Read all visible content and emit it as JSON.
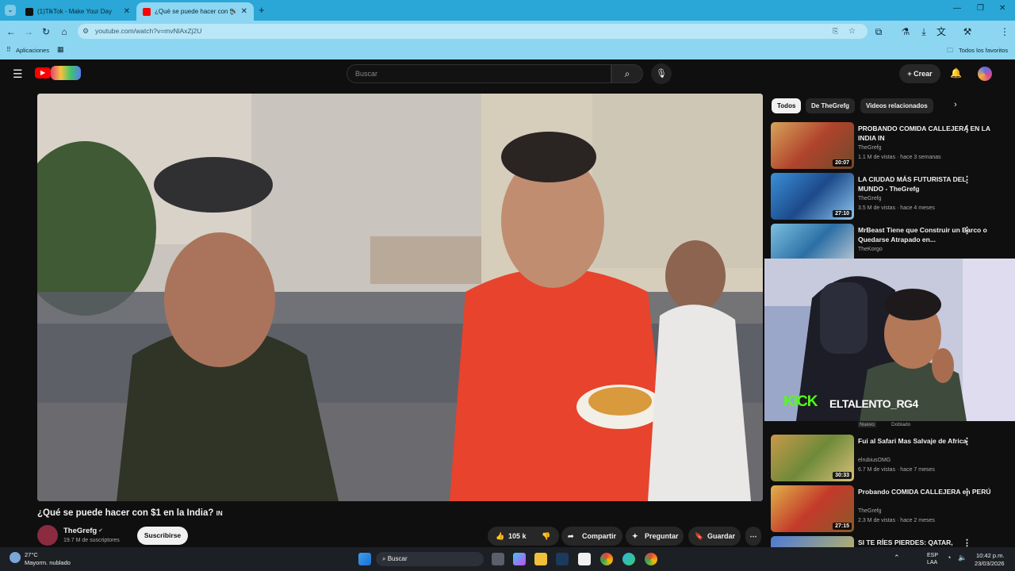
{
  "tabs": [
    {
      "label": "(1)TikTok - Make Your Day"
    },
    {
      "label": "¿Qué se puede hacer con $"
    }
  ],
  "address": "youtube.com/watch?v=mvNlAxZj2U",
  "bookmarks": {
    "apps": "Aplicaciones",
    "favorites": "Todos los favoritos"
  },
  "youtube": {
    "search_placeholder": "Buscar",
    "create_label": "Crear",
    "chips": [
      "Todos",
      "De TheGrefg",
      "Videos relacionados"
    ],
    "video_title": "¿Qué se puede hacer con $1 en la India? ",
    "video_title_badge": "IN",
    "channel": "TheGrefg",
    "subscribers": "19.7 M de suscriptores",
    "subscribe_label": "Suscribirse",
    "likes": "105 k",
    "share_label": "Compartir",
    "ask_label": "Preguntar",
    "save_label": "Guardar"
  },
  "recommendations": [
    {
      "title": "PROBANDO COMIDA CALLEJERA EN LA INDIA IN",
      "channel": "TheGrefg",
      "meta": "1.1 M de vistas · hace 3 semanas",
      "duration": "20:07"
    },
    {
      "title": "LA CIUDAD MÁS FUTURISTA DEL MUNDO - TheGrefg",
      "channel": "TheGrefg",
      "meta": "3.5 M de vistas · hace 4 meses",
      "duration": "27:10"
    },
    {
      "title": "MrBeast Tiene que Construir un Barco o Quedarse Atrapado en...",
      "channel": "TheKorgo",
      "meta": "",
      "duration": ""
    },
    {
      "title": "Fui al Safari Mas Salvaje de Africa",
      "channel": "elrubiusOMG",
      "meta": "6.7 M de vistas · hace 7 meses",
      "duration": "30:33"
    },
    {
      "title": "Probando COMIDA CALLEJERA en PERÚ",
      "channel": "TheGrefg",
      "meta": "2.3 M de vistas · hace 2 meses",
      "duration": "27:15"
    },
    {
      "title": "SI TE RÍES PIERDES: QATAR,",
      "channel": "",
      "meta": "",
      "duration": ""
    }
  ],
  "overlay": {
    "new_badge": "Nuevo",
    "dubbed_badge": "Doblado",
    "kick": "KICK",
    "streamer": "ELTALENTO_RG4"
  },
  "taskbar": {
    "weather_temp": "27°C",
    "weather_desc": "Mayorm. nublado",
    "search": "Buscar",
    "lang1": "ESP",
    "lang2": "LAA",
    "time": "10:42 p.m.",
    "date": "23/03/2026"
  },
  "colors": {
    "chrome_tabbar": "#2aa7d6",
    "chrome_toolbar": "#8dd6f2",
    "youtube_red": "#ff0000",
    "kick_green": "#53fc18"
  }
}
